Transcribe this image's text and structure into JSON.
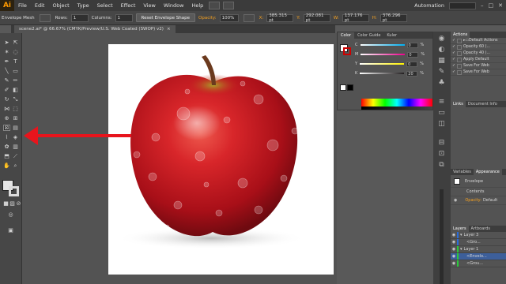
{
  "app": {
    "logo": "Ai",
    "workspace": "Automation"
  },
  "menu": [
    "File",
    "Edit",
    "Object",
    "Type",
    "Select",
    "Effect",
    "View",
    "Window",
    "Help"
  ],
  "control_bar": {
    "selection_label": "Envelope Mesh",
    "rows_label": "Rows:",
    "rows_value": "1",
    "columns_label": "Columns:",
    "columns_value": "1",
    "reset_button": "Reset Envelope Shape",
    "opacity_label": "Opacity:",
    "opacity_value": "100%",
    "x_label": "X:",
    "x_value": "385.315 pt",
    "y_label": "Y:",
    "y_value": "292.081 pt",
    "w_label": "W:",
    "w_value": "137.176 pt",
    "h_label": "H:",
    "h_value": "376.296 pt"
  },
  "document_tab": "scene2.ai* @ 66.67% (CMYK/Preview/U.S. Web Coated (SWOP) v2)",
  "color_panel": {
    "tabs": [
      "Color",
      "Color Guide",
      "Kuler"
    ],
    "channels": [
      {
        "label": "C",
        "value": "0",
        "unit": "%",
        "color": "#00aeef"
      },
      {
        "label": "M",
        "value": "0",
        "unit": "%",
        "color": "#ec008c"
      },
      {
        "label": "Y",
        "value": "0",
        "unit": "%",
        "color": "#fff200"
      },
      {
        "label": "K",
        "value": "20",
        "unit": "%",
        "color": "#231f20"
      }
    ]
  },
  "actions_panel": {
    "title": "Actions",
    "rows": [
      "Default Actions",
      "Opacity 60 (...",
      "Opacity 40 (...",
      "Apply Default",
      "Save For Web",
      "Save For Web"
    ]
  },
  "links_panel": {
    "tabs": [
      "Links",
      "Document Info"
    ]
  },
  "appearance_panel": {
    "tabs": [
      "Variables",
      "Appearance"
    ],
    "item": "Envelope",
    "contents": "Contents",
    "opacity_row": {
      "label": "Opacity:",
      "value": "Default"
    }
  },
  "layers_panel": {
    "tabs": [
      "Layers",
      "Artboards"
    ],
    "rows": [
      "Layer 3",
      "<Gro...",
      "Layer 1",
      "<Envelo...",
      "<Grou..."
    ]
  },
  "colors": {
    "accent": "#ff9a00",
    "arrow": "#e8141c",
    "apple_red": "#c8141c"
  }
}
